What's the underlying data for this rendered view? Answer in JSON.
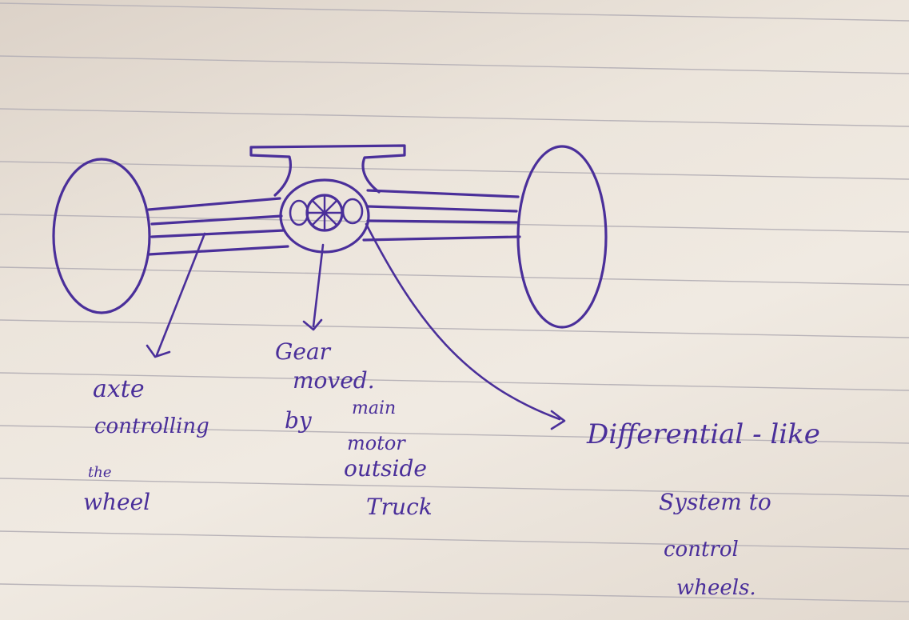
{
  "colors": {
    "ink": "#4a2f9a",
    "rule": "#b8b3b8",
    "paper": "#ebe4db"
  },
  "labels": {
    "axle": {
      "line1": "axte",
      "line2": "controlling",
      "line3": "the",
      "line4": "wheel"
    },
    "gear": {
      "line1": "Gear",
      "line2": "moved.",
      "line3": "by",
      "line4": "main",
      "line5": "motor",
      "line6": "outside",
      "line7": "Truck"
    },
    "differential": {
      "line1": "Differential - like",
      "line2": "System to",
      "line3": "control",
      "line4": "wheels."
    }
  }
}
